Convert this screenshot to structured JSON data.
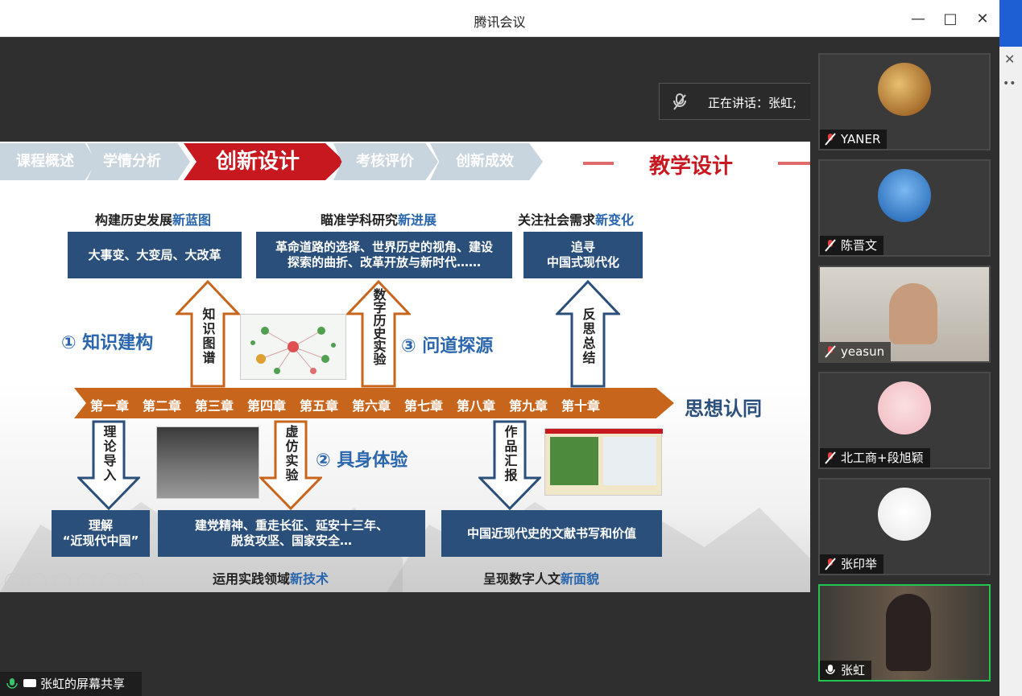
{
  "window": {
    "title": "腾讯会议"
  },
  "speaking": {
    "label": "正在讲话：张虹;"
  },
  "slide": {
    "nav": {
      "items": [
        "课程概述",
        "学情分析",
        "创新设计",
        "考核评价",
        "创新成效"
      ],
      "active_index": 2,
      "title": "教学设计"
    },
    "headings": {
      "h1a": "构建历史发展",
      "h1b": "新蓝图",
      "h2a": "瞄准学科研究",
      "h2b": "新进展",
      "h3a": "关注社会需求",
      "h3b": "新变化",
      "h4a": "运用实践领域",
      "h4b": "新技术",
      "h5a": "呈现数字人文",
      "h5b": "新面貌"
    },
    "boxes": {
      "b1": "大事变、大变局、大改革",
      "b2a": "革命道路的选择、世界历史的视角、建设",
      "b2b": "探索的曲折、改革开放与新时代……",
      "b3a": "追寻",
      "b3b": "中国式现代化",
      "b4a": "理解",
      "b4b": "“近现代中国”",
      "b5a": "建党精神、重走长征、延安十三年、",
      "b5b": "脱贫攻坚、国家安全…",
      "b6": "中国近现代史的文献书写和价值"
    },
    "sections": {
      "s1": "① 知识建构",
      "s2": "② 具身体验",
      "s3": "③ 问道探源"
    },
    "arrows": {
      "a1": "知识图谱",
      "a2": "数字历史实验",
      "a3": "反思总结",
      "a4": "理论导入",
      "a5": "虚仿实验",
      "a6": "作品汇报"
    },
    "chapters": [
      "第一章",
      "第二章",
      "第三章",
      "第四章",
      "第五章",
      "第六章",
      "第七章",
      "第八章",
      "第九章",
      "第十章"
    ],
    "end_label": "思想认同"
  },
  "participants": [
    {
      "name": "YANER",
      "muted": true
    },
    {
      "name": "陈晋文",
      "muted": true
    },
    {
      "name": "yeasun",
      "muted": true
    },
    {
      "name": "北工商+段旭颖",
      "muted": true
    },
    {
      "name": "张印举",
      "muted": true
    },
    {
      "name": "张虹",
      "muted": false,
      "active": true
    }
  ],
  "share_label": "张虹的屏幕共享",
  "colors": {
    "accent_red": "#c8181f",
    "navy": "#2a4f7a",
    "orange": "#c8651c",
    "active_green": "#23c552"
  }
}
